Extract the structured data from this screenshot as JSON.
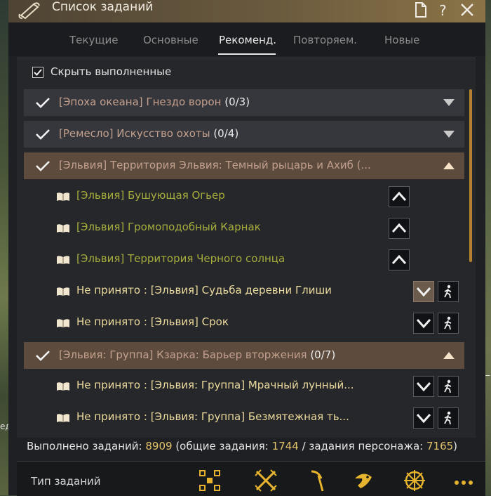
{
  "window": {
    "title": "Список заданий"
  },
  "background": {
    "left_text": "ед",
    "right_text": "—"
  },
  "tabs": [
    {
      "label": "Текущие"
    },
    {
      "label": "Основные"
    },
    {
      "label": "Рекоменд."
    },
    {
      "label": "Повторяем."
    },
    {
      "label": "Новые"
    }
  ],
  "active_tab": "Рекоменд.",
  "hide_completed": {
    "label": "Скрыть выполненные",
    "checked": true
  },
  "groups": [
    {
      "category": "[Эпоха океана] Гнездо ворон",
      "count": "(0/3)",
      "expanded": false
    },
    {
      "category": "[Ремесло] Искусство охоты",
      "count": "(0/4)",
      "expanded": false
    },
    {
      "category": "[Эльвия] Территория Эльвия: Темный рыцарь и Ахиб (...",
      "count": "",
      "expanded": true,
      "items": [
        {
          "title": "[Эльвия] Бушующая Огьер"
        },
        {
          "title": "[Эльвия] Громоподобный Карнак"
        },
        {
          "title": "[Эльвия] Территория Черного солнца"
        },
        {
          "title": "Не принято : [Эльвия] Судьба деревни Глиши"
        },
        {
          "title": "Не принято : [Эльвия] Срок"
        }
      ]
    },
    {
      "category": "[Эльвия: Группа] Кзарка: Барьер вторжения",
      "count": "(0/7)",
      "expanded": true,
      "items": [
        {
          "title": "Не принято : [Эльвия: Группа] Мрачный лунный..."
        },
        {
          "title": "Не принято : [Эльвия: Группа] Безмятежная ть..."
        }
      ]
    }
  ],
  "stats": {
    "prefix": "Выполнено заданий: ",
    "total": "8909",
    "mid1": " (общие задания: ",
    "general": "1744",
    "mid2": " / задания персонажа: ",
    "character": "7165",
    "suffix": ")"
  },
  "bottom": {
    "quest_type_label": "Тип заданий"
  },
  "colors": {
    "accent": "#e0c26a",
    "green_quest": "#a6ad3c",
    "yellow_quest": "#ecdb9e",
    "title_bar": "#6a5a3e"
  }
}
